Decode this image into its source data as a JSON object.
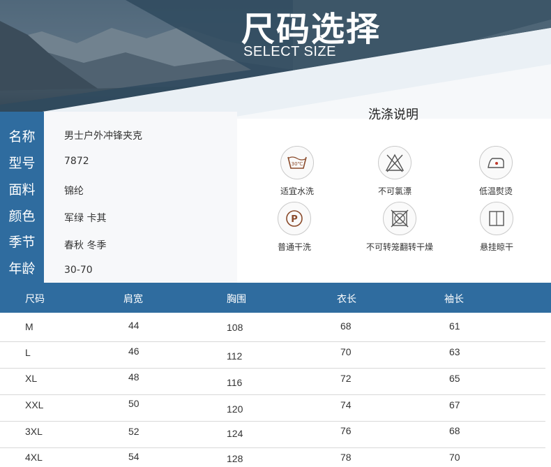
{
  "header": {
    "title_cn": "尺码选择",
    "title_en": "SELECT SIZE"
  },
  "product_info": [
    {
      "label": "名称",
      "value": "男士户外冲锋夹克"
    },
    {
      "label": "型号",
      "value": "7872"
    },
    {
      "label": "面料",
      "value": "锦纶"
    },
    {
      "label": "颜色",
      "value": "军绿 卡其"
    },
    {
      "label": "季节",
      "value": "春秋 冬季"
    },
    {
      "label": "年龄",
      "value": "30-70"
    }
  ],
  "washing": {
    "title": "洗涤说明",
    "items": [
      {
        "label": "适宜水洗",
        "icon": "wash-30-icon",
        "text": "30℃"
      },
      {
        "label": "不可氯漂",
        "icon": "no-bleach-icon"
      },
      {
        "label": "低温熨烫",
        "icon": "low-iron-icon"
      },
      {
        "label": "普通干洗",
        "icon": "dry-clean-p-icon",
        "text": "P"
      },
      {
        "label": "不可转笼翻转干燥",
        "icon": "no-tumble-dry-icon"
      },
      {
        "label": "悬挂晾干",
        "icon": "hang-dry-icon"
      }
    ]
  },
  "size_table": {
    "headers": [
      "尺码",
      "肩宽",
      "胸围",
      "衣长",
      "袖长"
    ],
    "rows": [
      [
        "M",
        "44",
        "108",
        "68",
        "61"
      ],
      [
        "L",
        "46",
        "112",
        "70",
        "63"
      ],
      [
        "XL",
        "48",
        "116",
        "72",
        "65"
      ],
      [
        "XXL",
        "50",
        "120",
        "74",
        "67"
      ],
      [
        "3XL",
        "52",
        "124",
        "76",
        "68"
      ],
      [
        "4XL",
        "54",
        "128",
        "78",
        "70"
      ]
    ]
  },
  "colors": {
    "accent": "#2f6c9f",
    "banner_dark": "#2c4253"
  }
}
